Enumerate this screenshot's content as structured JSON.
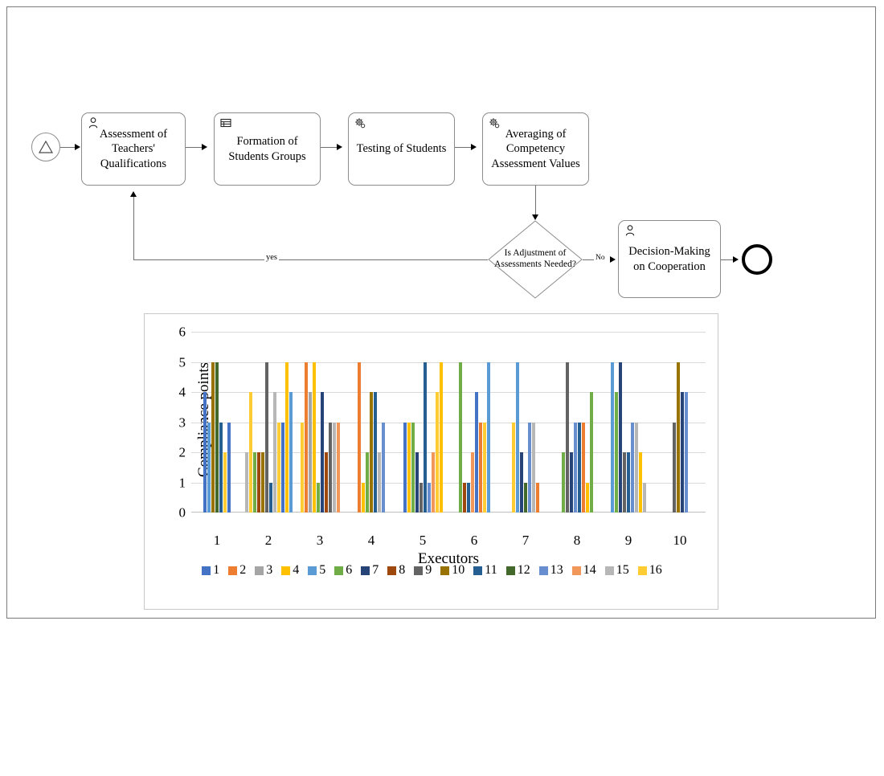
{
  "flow": {
    "start_event": {
      "name": "start-event",
      "icon": "triangle-signal-icon"
    },
    "end_event": {
      "name": "end-event"
    },
    "tasks": [
      {
        "id": "t1",
        "label": "Assessment of Teachers' Qualifications",
        "icon": "user-task-icon"
      },
      {
        "id": "t2",
        "label": "Formation of Students Groups",
        "icon": "manual-task-icon"
      },
      {
        "id": "t3",
        "label": "Testing of Students",
        "icon": "service-task-icon"
      },
      {
        "id": "t4",
        "label": "Averaging of Competency Assessment Values",
        "icon": "service-task-icon"
      },
      {
        "id": "t5",
        "label": "Decision-Making on Cooperation",
        "icon": "user-task-icon"
      }
    ],
    "gateway": {
      "label": "Is Adjustment of Assessments Needed?"
    },
    "edges": {
      "yes_label": "yes",
      "no_label": "No"
    }
  },
  "chart_data": {
    "type": "bar",
    "title": "",
    "xlabel": "Executors",
    "ylabel": "Compliance points",
    "ylim": [
      0,
      6
    ],
    "yticks": [
      0,
      1,
      2,
      3,
      4,
      5,
      6
    ],
    "grid": true,
    "legend_position": "bottom",
    "categories": [
      "1",
      "2",
      "3",
      "4",
      "5",
      "6",
      "7",
      "8",
      "9",
      "10"
    ],
    "series_names": [
      "1",
      "2",
      "3",
      "4",
      "5",
      "6",
      "7",
      "8",
      "9",
      "10",
      "11",
      "12",
      "13",
      "14",
      "15",
      "16"
    ],
    "series_colors": [
      "#4472C4",
      "#ED7D31",
      "#A5A5A5",
      "#FFC000",
      "#5B9BD5",
      "#70AD47",
      "#264478",
      "#9E480E",
      "#636363",
      "#997300",
      "#255E91",
      "#43682B",
      "#698ED0",
      "#F1975A",
      "#B7B7B7",
      "#FFCD33"
    ],
    "groups": [
      {
        "category": "1",
        "bars": [
          {
            "series": "1",
            "color": "#4472C4",
            "value": 4
          },
          {
            "series": "5",
            "color": "#5B9BD5",
            "value": 3
          },
          {
            "series": "10",
            "color": "#997300",
            "value": 5
          },
          {
            "series": "12",
            "color": "#43682B",
            "value": 5
          },
          {
            "series": "11",
            "color": "#255E91",
            "value": 3
          },
          {
            "series": "16",
            "color": "#FFCD33",
            "value": 2
          },
          {
            "series": "1",
            "color": "#4472C4",
            "value": 3
          }
        ]
      },
      {
        "category": "2",
        "bars": [
          {
            "series": "15",
            "color": "#B7B7B7",
            "value": 2
          },
          {
            "series": "16",
            "color": "#FFCD33",
            "value": 4
          },
          {
            "series": "6",
            "color": "#70AD47",
            "value": 2
          },
          {
            "series": "8",
            "color": "#9E480E",
            "value": 2
          },
          {
            "series": "10",
            "color": "#997300",
            "value": 2
          },
          {
            "series": "9",
            "color": "#636363",
            "value": 5
          },
          {
            "series": "11",
            "color": "#255E91",
            "value": 1
          },
          {
            "series": "15",
            "color": "#B7B7B7",
            "value": 4
          },
          {
            "series": "16",
            "color": "#FFCD33",
            "value": 3
          },
          {
            "series": "1",
            "color": "#4472C4",
            "value": 3
          },
          {
            "series": "4",
            "color": "#FFC000",
            "value": 5
          },
          {
            "series": "5",
            "color": "#5B9BD5",
            "value": 4
          }
        ]
      },
      {
        "category": "3",
        "bars": [
          {
            "series": "16",
            "color": "#FFCD33",
            "value": 3
          },
          {
            "series": "2",
            "color": "#ED7D31",
            "value": 5
          },
          {
            "series": "3",
            "color": "#A5A5A5",
            "value": 4
          },
          {
            "series": "4",
            "color": "#FFC000",
            "value": 5
          },
          {
            "series": "6",
            "color": "#70AD47",
            "value": 1
          },
          {
            "series": "7",
            "color": "#264478",
            "value": 4
          },
          {
            "series": "8",
            "color": "#9E480E",
            "value": 2
          },
          {
            "series": "9",
            "color": "#636363",
            "value": 3
          },
          {
            "series": "15",
            "color": "#B7B7B7",
            "value": 3
          },
          {
            "series": "14",
            "color": "#F1975A",
            "value": 3
          }
        ]
      },
      {
        "category": "4",
        "bars": [
          {
            "series": "2",
            "color": "#ED7D31",
            "value": 5
          },
          {
            "series": "4",
            "color": "#FFC000",
            "value": 1
          },
          {
            "series": "6",
            "color": "#70AD47",
            "value": 2
          },
          {
            "series": "10",
            "color": "#997300",
            "value": 4
          },
          {
            "series": "11",
            "color": "#255E91",
            "value": 4
          },
          {
            "series": "15",
            "color": "#B7B7B7",
            "value": 2
          },
          {
            "series": "13",
            "color": "#698ED0",
            "value": 3
          }
        ]
      },
      {
        "category": "5",
        "bars": [
          {
            "series": "1",
            "color": "#4472C4",
            "value": 3
          },
          {
            "series": "4",
            "color": "#FFC000",
            "value": 3
          },
          {
            "series": "6",
            "color": "#70AD47",
            "value": 3
          },
          {
            "series": "7",
            "color": "#264478",
            "value": 2
          },
          {
            "series": "9",
            "color": "#636363",
            "value": 1
          },
          {
            "series": "11",
            "color": "#255E91",
            "value": 5
          },
          {
            "series": "13",
            "color": "#698ED0",
            "value": 1
          },
          {
            "series": "14",
            "color": "#F1975A",
            "value": 2
          },
          {
            "series": "16",
            "color": "#FFCD33",
            "value": 4
          },
          {
            "series": "4",
            "color": "#FFC000",
            "value": 5
          }
        ]
      },
      {
        "category": "6",
        "bars": [
          {
            "series": "6",
            "color": "#70AD47",
            "value": 5
          },
          {
            "series": "8",
            "color": "#9E480E",
            "value": 1
          },
          {
            "series": "11",
            "color": "#255E91",
            "value": 1
          },
          {
            "series": "14",
            "color": "#F1975A",
            "value": 2
          },
          {
            "series": "1",
            "color": "#4472C4",
            "value": 4
          },
          {
            "series": "2",
            "color": "#ED7D31",
            "value": 3
          },
          {
            "series": "16",
            "color": "#FFCD33",
            "value": 3
          },
          {
            "series": "5",
            "color": "#5B9BD5",
            "value": 5
          }
        ]
      },
      {
        "category": "7",
        "bars": [
          {
            "series": "16",
            "color": "#FFCD33",
            "value": 3
          },
          {
            "series": "5",
            "color": "#5B9BD5",
            "value": 5
          },
          {
            "series": "7",
            "color": "#264478",
            "value": 2
          },
          {
            "series": "12",
            "color": "#43682B",
            "value": 1
          },
          {
            "series": "13",
            "color": "#698ED0",
            "value": 3
          },
          {
            "series": "15",
            "color": "#B7B7B7",
            "value": 3
          },
          {
            "series": "2",
            "color": "#ED7D31",
            "value": 1
          }
        ]
      },
      {
        "category": "8",
        "bars": [
          {
            "series": "6",
            "color": "#70AD47",
            "value": 2
          },
          {
            "series": "9",
            "color": "#636363",
            "value": 5
          },
          {
            "series": "7",
            "color": "#264478",
            "value": 2
          },
          {
            "series": "13",
            "color": "#698ED0",
            "value": 3
          },
          {
            "series": "11",
            "color": "#255E91",
            "value": 3
          },
          {
            "series": "2",
            "color": "#ED7D31",
            "value": 3
          },
          {
            "series": "4",
            "color": "#FFC000",
            "value": 1
          },
          {
            "series": "6",
            "color": "#70AD47",
            "value": 4
          }
        ]
      },
      {
        "category": "9",
        "bars": [
          {
            "series": "5",
            "color": "#5B9BD5",
            "value": 5
          },
          {
            "series": "6",
            "color": "#70AD47",
            "value": 4
          },
          {
            "series": "7",
            "color": "#264478",
            "value": 5
          },
          {
            "series": "9",
            "color": "#636363",
            "value": 2
          },
          {
            "series": "11",
            "color": "#255E91",
            "value": 2
          },
          {
            "series": "13",
            "color": "#698ED0",
            "value": 3
          },
          {
            "series": "15",
            "color": "#B7B7B7",
            "value": 3
          },
          {
            "series": "4",
            "color": "#FFC000",
            "value": 2
          },
          {
            "series": "15",
            "color": "#B7B7B7",
            "value": 1
          }
        ]
      },
      {
        "category": "10",
        "bars": [
          {
            "series": "9",
            "color": "#636363",
            "value": 3
          },
          {
            "series": "10",
            "color": "#997300",
            "value": 5
          },
          {
            "series": "7",
            "color": "#264478",
            "value": 4
          },
          {
            "series": "13",
            "color": "#698ED0",
            "value": 4
          }
        ]
      }
    ]
  }
}
